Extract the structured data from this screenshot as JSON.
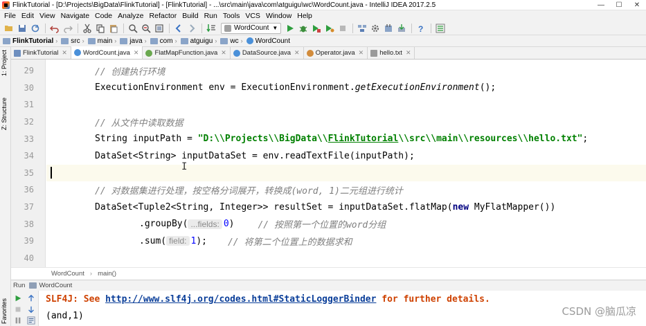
{
  "window": {
    "title": "FlinkTutorial - [D:\\Projects\\BigData\\FlinkTutorial] - [FlinkTutorial] - ...\\src\\main\\java\\com\\atguigu\\wc\\WordCount.java - IntelliJ IDEA 2017.2.5",
    "minimize": "—",
    "maximize": "☐",
    "close": "✕"
  },
  "menu": [
    "File",
    "Edit",
    "View",
    "Navigate",
    "Code",
    "Analyze",
    "Refactor",
    "Build",
    "Run",
    "Tools",
    "VCS",
    "Window",
    "Help"
  ],
  "toolbar": {
    "run_config": "WordCount"
  },
  "navbar": [
    "FlinkTutorial",
    "src",
    "main",
    "java",
    "com",
    "atguigu",
    "wc",
    "WordCount"
  ],
  "left_stripe": {
    "project": "1: Project",
    "structure": "Z: Structure",
    "favorites": "Favorites"
  },
  "tabs": [
    {
      "label": "FlinkTutorial",
      "icon": "module-icon",
      "color": "#6e8fbf"
    },
    {
      "label": "WordCount.java",
      "icon": "class-icon",
      "color": "#4a90d9"
    },
    {
      "label": "FlatMapFunction.java",
      "icon": "interface-icon",
      "color": "#6aa84f"
    },
    {
      "label": "DataSource.java",
      "icon": "class-icon",
      "color": "#4a90d9"
    },
    {
      "label": "Operator.java",
      "icon": "abstract-class-icon",
      "color": "#d28c3c"
    },
    {
      "label": "hello.txt",
      "icon": "text-file-icon",
      "color": "#9a9a9a"
    }
  ],
  "editor": {
    "line_numbers": [
      "29",
      "30",
      "31",
      "32",
      "33",
      "34",
      "35",
      "36",
      "37",
      "38",
      "39",
      "40"
    ],
    "comment_create_env": "// 创建执行环境",
    "env_decl": "ExecutionEnvironment env = ExecutionEnvironment.",
    "env_call": "getExecutionEnvironment",
    "env_end": "();",
    "comment_read_file": "// 从文件中读取数据",
    "input_path_decl": "String inputPath = ",
    "input_path_value_1": "\"D:\\\\Projects\\\\BigData\\\\",
    "input_path_value_2": "FlinkTutorial",
    "input_path_value_3": "\\\\src\\\\main\\\\resources\\\\hello.txt\"",
    "semicolon": ";",
    "dataset_decl": "DataSet<String> inputDataSet = env.readTextFile(inputPath);",
    "comment_process": "// 对数据集进行处理，按空格分词展开，转换成(word, 1)二元组进行统计",
    "result_decl": "DataSet<Tuple2<String, Integer>> resultSet = inputDataSet.flatMap(",
    "kw_new": "new",
    "result_end": " MyFlatMapper())",
    "groupby_call": ".groupBy(",
    "groupby_hint": "...fields:",
    "groupby_arg": "0",
    "groupby_close": ")",
    "comment_groupby": "// 按照第一个位置的word分组",
    "sum_call": ".sum(",
    "sum_hint": "field:",
    "sum_arg": "1",
    "sum_close": ");",
    "comment_sum": "// 将第二个位置上的数据求和"
  },
  "editor_breadcrumb": [
    "WordCount",
    "main()"
  ],
  "run": {
    "tool_label": "Run",
    "config_tab": "WordCount",
    "slf4j_prefix": "SLF4J: See ",
    "slf4j_link": "http://www.slf4j.org/codes.html#StaticLoggerBinder",
    "slf4j_suffix": " for further details.",
    "output_line": "(and,1)"
  },
  "watermark": "CSDN @脑瓜凉"
}
